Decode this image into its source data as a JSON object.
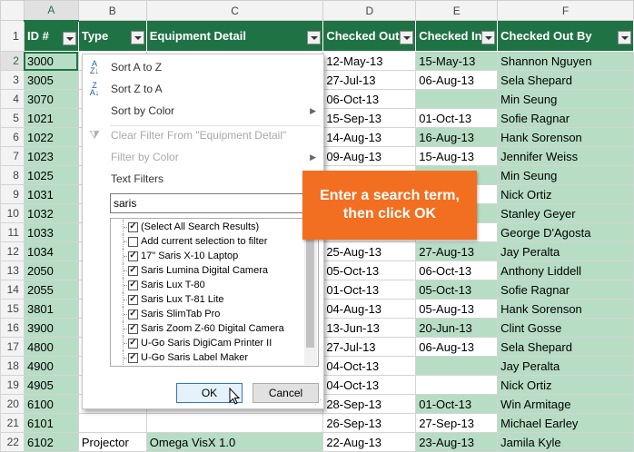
{
  "columns": [
    "A",
    "B",
    "C",
    "D",
    "E",
    "F"
  ],
  "header": {
    "row_num": "1",
    "cells": [
      "ID #",
      "Type",
      "Equipment Detail",
      "Checked Out",
      "Checked In",
      "Checked Out By"
    ]
  },
  "rows": [
    {
      "n": "2",
      "id": "3000",
      "type": "",
      "detail": "",
      "out": "12-May-13",
      "in": "15-May-13",
      "by": "Shannon Nguyen"
    },
    {
      "n": "3",
      "id": "3005",
      "type": "",
      "detail": "",
      "out": "27-Jul-13",
      "in": "06-Aug-13",
      "by": "Sela Shepard"
    },
    {
      "n": "4",
      "id": "3070",
      "type": "",
      "detail": "",
      "out": "06-Oct-13",
      "in": "",
      "by": "Min Seung"
    },
    {
      "n": "5",
      "id": "1021",
      "type": "",
      "detail": "",
      "out": "15-Sep-13",
      "in": "01-Oct-13",
      "by": "Sofie Ragnar"
    },
    {
      "n": "6",
      "id": "1022",
      "type": "",
      "detail": "",
      "out": "14-Aug-13",
      "in": "16-Aug-13",
      "by": "Hank Sorenson"
    },
    {
      "n": "7",
      "id": "1023",
      "type": "",
      "detail": "",
      "out": "09-Aug-13",
      "in": "15-Aug-13",
      "by": "Jennifer Weiss"
    },
    {
      "n": "8",
      "id": "1025",
      "type": "",
      "detail": "",
      "out": "",
      "in": "",
      "by": "Min Seung"
    },
    {
      "n": "9",
      "id": "1031",
      "type": "",
      "detail": "",
      "out": "",
      "in": "",
      "by": "Nick Ortiz"
    },
    {
      "n": "10",
      "id": "1032",
      "type": "",
      "detail": "",
      "out": "",
      "in": "",
      "by": "Stanley Geyer"
    },
    {
      "n": "11",
      "id": "1033",
      "type": "",
      "detail": "",
      "out": "",
      "in": "",
      "by": "George D'Agosta"
    },
    {
      "n": "12",
      "id": "1034",
      "type": "",
      "detail": "",
      "out": "25-Aug-13",
      "in": "27-Aug-13",
      "by": "Jay Peralta"
    },
    {
      "n": "13",
      "id": "2050",
      "type": "",
      "detail": "",
      "out": "05-Oct-13",
      "in": "06-Oct-13",
      "by": "Anthony Liddell"
    },
    {
      "n": "14",
      "id": "2055",
      "type": "",
      "detail": "",
      "out": "01-Oct-13",
      "in": "05-Oct-13",
      "by": "Sofie Ragnar"
    },
    {
      "n": "15",
      "id": "3801",
      "type": "",
      "detail": "",
      "out": "04-Aug-13",
      "in": "05-Aug-13",
      "by": "Hank Sorenson"
    },
    {
      "n": "16",
      "id": "3900",
      "type": "",
      "detail": "",
      "out": "13-Jun-13",
      "in": "20-Jun-13",
      "by": "Clint Gosse"
    },
    {
      "n": "17",
      "id": "4800",
      "type": "",
      "detail": "",
      "out": "27-Jul-13",
      "in": "06-Aug-13",
      "by": "Sela Shepard"
    },
    {
      "n": "18",
      "id": "4900",
      "type": "",
      "detail": "",
      "out": "04-Oct-13",
      "in": "",
      "by": "Jay Peralta"
    },
    {
      "n": "19",
      "id": "4905",
      "type": "",
      "detail": "",
      "out": "04-Oct-13",
      "in": "",
      "by": "Nick Ortiz"
    },
    {
      "n": "20",
      "id": "6100",
      "type": "",
      "detail": "",
      "out": "28-Sep-13",
      "in": "01-Oct-13",
      "by": "Win Armitage"
    },
    {
      "n": "21",
      "id": "6101",
      "type": "",
      "detail": "",
      "out": "26-Sep-13",
      "in": "27-Sep-13",
      "by": "Michael Earley"
    },
    {
      "n": "22",
      "id": "6102",
      "type": "Projector",
      "detail": "Omega VisX 1.0",
      "out": "22-Aug-13",
      "in": "23-Aug-13",
      "by": "Jamila Kyle"
    }
  ],
  "menu": {
    "sort_az": "Sort A to Z",
    "sort_za": "Sort Z to A",
    "sort_color": "Sort by Color",
    "clear_filter": "Clear Filter From \"Equipment Detail\"",
    "filter_color": "Filter by Color",
    "text_filters": "Text Filters",
    "search_value": "saris",
    "items": [
      {
        "label": "(Select All Search Results)",
        "checked": true
      },
      {
        "label": "Add current selection to filter",
        "checked": false
      },
      {
        "label": "17\" Saris X-10 Laptop",
        "checked": true
      },
      {
        "label": "Saris Lumina Digital Camera",
        "checked": true
      },
      {
        "label": "Saris Lux T-80",
        "checked": true
      },
      {
        "label": "Saris Lux T-81 Lite",
        "checked": true
      },
      {
        "label": "Saris SlimTab Pro",
        "checked": true
      },
      {
        "label": "Saris Zoom Z-60 Digital Camera",
        "checked": true
      },
      {
        "label": "U-Go Saris DigiCam Printer II",
        "checked": true
      },
      {
        "label": "U-Go Saris Label Maker",
        "checked": true
      }
    ],
    "ok_label": "OK",
    "cancel_label": "Cancel"
  },
  "callout": {
    "line1": "Enter a search term,",
    "line2": "then click OK"
  },
  "colors": {
    "header_green": "#1f7244",
    "band_green": "#b7ddc5",
    "callout_orange": "#f26f21"
  }
}
